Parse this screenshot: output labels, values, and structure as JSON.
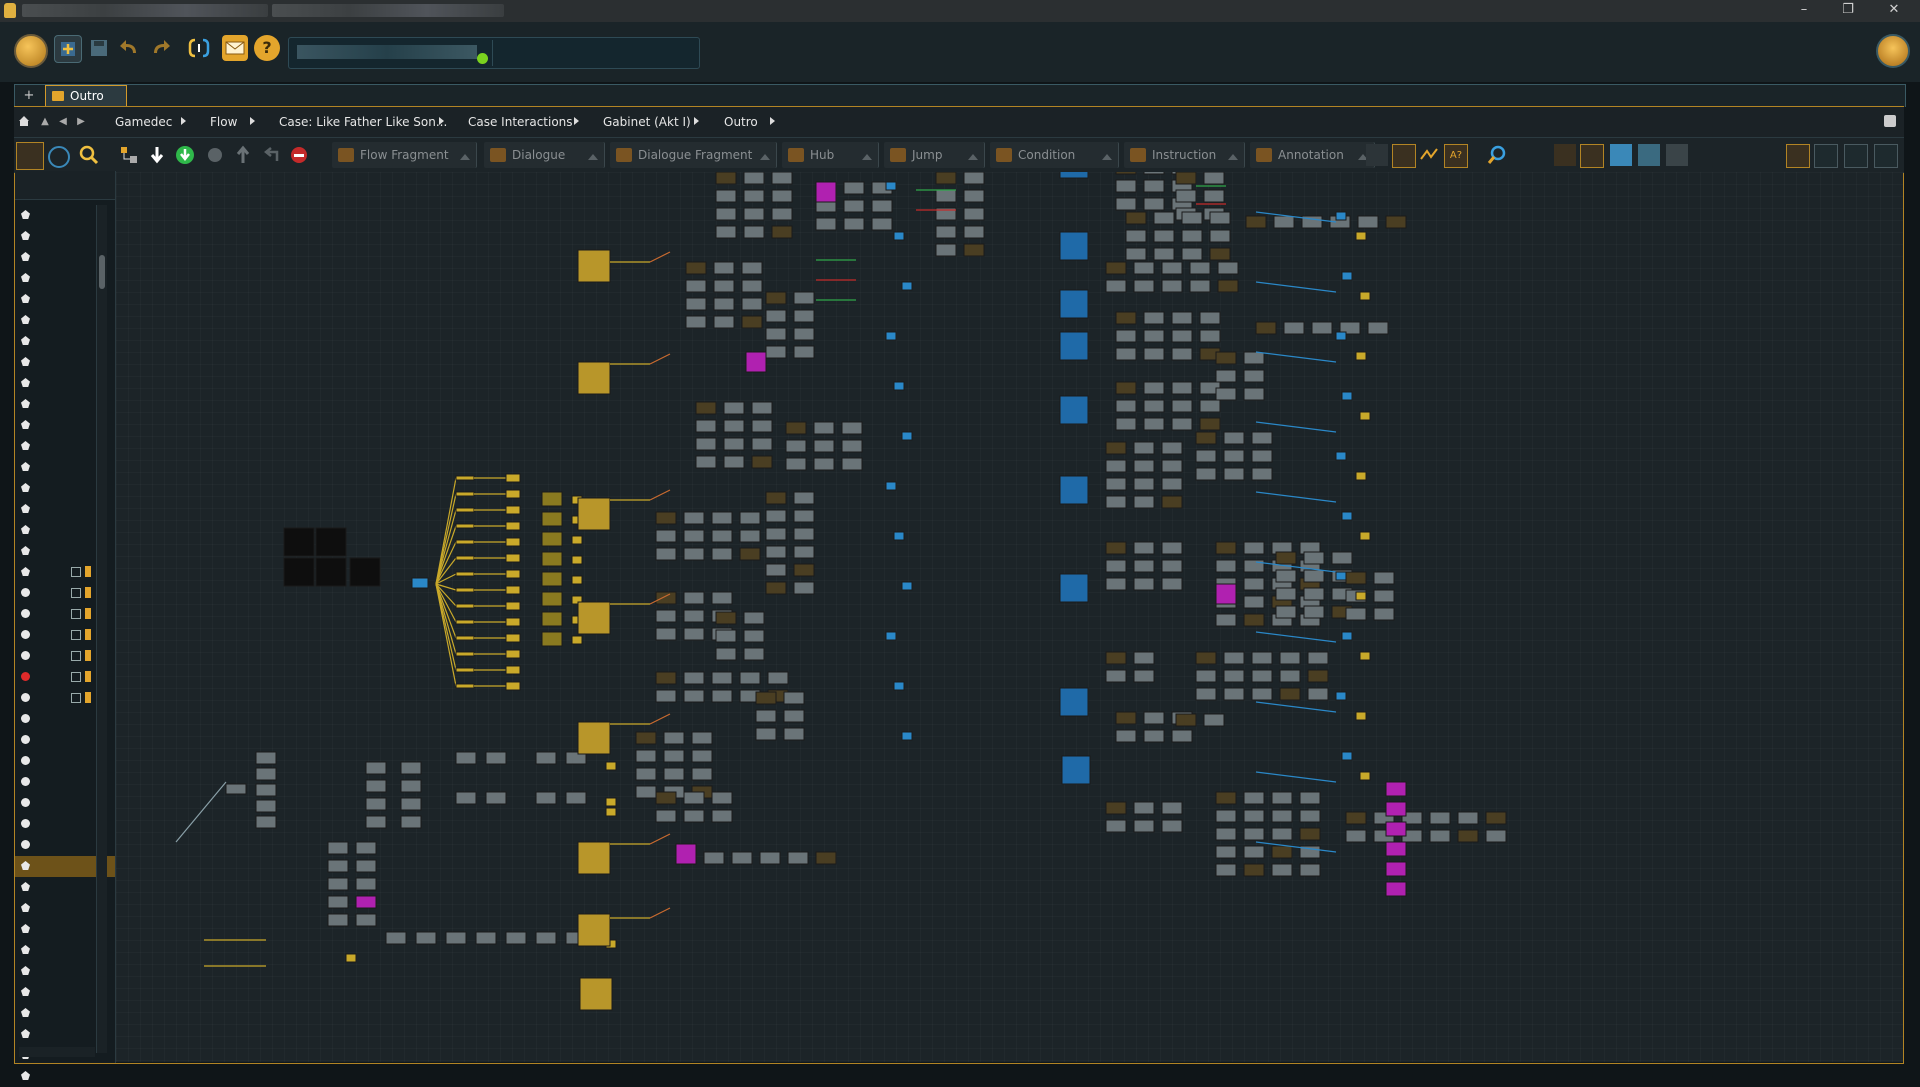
{
  "window": {
    "controls": {
      "minimize": "–",
      "maximize": "❐",
      "close": "✕"
    }
  },
  "main_toolbar": {
    "icons": [
      "app-menu-icon",
      "new-icon",
      "save-icon",
      "undo-icon",
      "redo-icon",
      "sync-icon",
      "mail-icon",
      "help-icon"
    ],
    "status_color": "#7bd21f"
  },
  "document_tabs": {
    "add_label": "+",
    "tabs": [
      {
        "label": "Outro",
        "icon": "flow-folder-icon"
      }
    ]
  },
  "breadcrumb": {
    "items": [
      "Gamedec",
      "Flow",
      "Case: Like Father Like Son...",
      "Case Interactions",
      "Gabinet (Akt I)",
      "Outro"
    ]
  },
  "node_palette": {
    "items": [
      {
        "label": "Flow Fragment",
        "color": "#7a5422"
      },
      {
        "label": "Dialogue",
        "color": "#7a5422"
      },
      {
        "label": "Dialogue Fragment",
        "color": "#7a5422"
      },
      {
        "label": "Hub",
        "color": "#7a5422"
      },
      {
        "label": "Jump",
        "color": "#7a5422"
      },
      {
        "label": "Condition",
        "color": "#7a5422"
      },
      {
        "label": "Instruction",
        "color": "#7a5422"
      },
      {
        "label": "Annotation",
        "color": "#7a5422"
      }
    ]
  },
  "colors": {
    "accent": "#d49a2a",
    "node_yellow": "#c9a92a",
    "node_blue": "#1f6aa8",
    "node_magenta": "#b021b0",
    "node_gray": "#8c979c",
    "conn_green": "#2fa84a",
    "conn_red": "#c42a2a",
    "conn_blue": "#2a88c8"
  }
}
